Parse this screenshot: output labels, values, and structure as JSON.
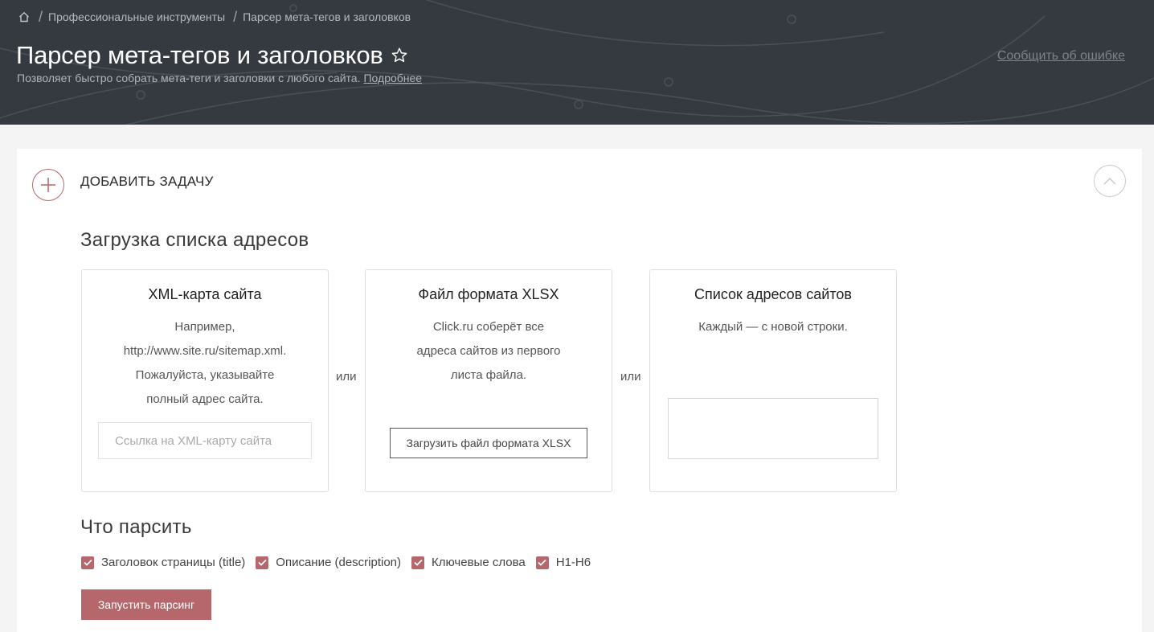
{
  "breadcrumb": {
    "home_icon": "home-icon",
    "items": [
      "Профессиональные инструменты",
      "Парсер мета-тегов и заголовков"
    ]
  },
  "header": {
    "title": "Парсер мета-тегов и заголовков",
    "subtitle": "Позволяет быстро собрать мета-теги и заголовки с любого сайта.",
    "more_link": "Подробнее",
    "report_link": "Сообщить об ошибке",
    "favorite_icon": "star-outline-icon"
  },
  "task": {
    "title": "ДОБАВИТЬ ЗАДАЧУ",
    "add_icon": "plus-icon",
    "collapse_icon": "chevron-up-icon"
  },
  "upload": {
    "section_title": "Загрузка списка адресов",
    "or_label": "или",
    "xml": {
      "title": "XML-карта сайта",
      "desc": [
        "Например,",
        "http://www.site.ru/sitemap.xml.",
        "Пожалуйста, указывайте",
        "полный адрес сайта."
      ],
      "placeholder": "Ссылка на XML-карту сайта",
      "value": ""
    },
    "xlsx": {
      "title": "Файл формата XLSX",
      "desc": [
        "Click.ru соберёт все",
        "адреса сайтов из первого",
        "листа файла."
      ],
      "button": "Загрузить файл формата XLSX"
    },
    "list": {
      "title": "Список адресов сайтов",
      "desc": [
        "Каждый — с новой строки."
      ],
      "value": ""
    }
  },
  "parse": {
    "section_title": "Что парсить",
    "options": [
      {
        "label": "Заголовок страницы (title)",
        "checked": true
      },
      {
        "label": "Описание (description)",
        "checked": true
      },
      {
        "label": "Ключевые слова",
        "checked": true
      },
      {
        "label": "H1-H6",
        "checked": true
      }
    ],
    "run_button": "Запустить парсинг"
  },
  "colors": {
    "header_bg": "#353a41",
    "accent": "#b5676b",
    "page_bg": "#f4f4f4"
  }
}
